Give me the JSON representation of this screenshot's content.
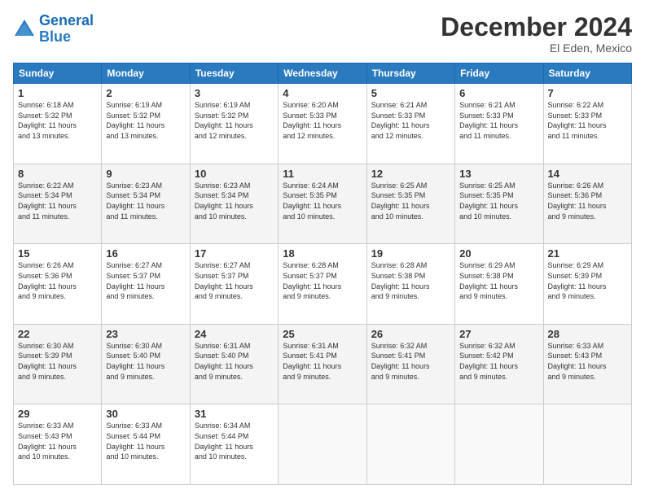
{
  "logo": {
    "line1": "General",
    "line2": "Blue"
  },
  "title": "December 2024",
  "location": "El Eden, Mexico",
  "days_header": [
    "Sunday",
    "Monday",
    "Tuesday",
    "Wednesday",
    "Thursday",
    "Friday",
    "Saturday"
  ],
  "weeks": [
    [
      {
        "day": "1",
        "info": "Sunrise: 6:18 AM\nSunset: 5:32 PM\nDaylight: 11 hours\nand 13 minutes."
      },
      {
        "day": "2",
        "info": "Sunrise: 6:19 AM\nSunset: 5:32 PM\nDaylight: 11 hours\nand 13 minutes."
      },
      {
        "day": "3",
        "info": "Sunrise: 6:19 AM\nSunset: 5:32 PM\nDaylight: 11 hours\nand 12 minutes."
      },
      {
        "day": "4",
        "info": "Sunrise: 6:20 AM\nSunset: 5:33 PM\nDaylight: 11 hours\nand 12 minutes."
      },
      {
        "day": "5",
        "info": "Sunrise: 6:21 AM\nSunset: 5:33 PM\nDaylight: 11 hours\nand 12 minutes."
      },
      {
        "day": "6",
        "info": "Sunrise: 6:21 AM\nSunset: 5:33 PM\nDaylight: 11 hours\nand 11 minutes."
      },
      {
        "day": "7",
        "info": "Sunrise: 6:22 AM\nSunset: 5:33 PM\nDaylight: 11 hours\nand 11 minutes."
      }
    ],
    [
      {
        "day": "8",
        "info": "Sunrise: 6:22 AM\nSunset: 5:34 PM\nDaylight: 11 hours\nand 11 minutes."
      },
      {
        "day": "9",
        "info": "Sunrise: 6:23 AM\nSunset: 5:34 PM\nDaylight: 11 hours\nand 11 minutes."
      },
      {
        "day": "10",
        "info": "Sunrise: 6:23 AM\nSunset: 5:34 PM\nDaylight: 11 hours\nand 10 minutes."
      },
      {
        "day": "11",
        "info": "Sunrise: 6:24 AM\nSunset: 5:35 PM\nDaylight: 11 hours\nand 10 minutes."
      },
      {
        "day": "12",
        "info": "Sunrise: 6:25 AM\nSunset: 5:35 PM\nDaylight: 11 hours\nand 10 minutes."
      },
      {
        "day": "13",
        "info": "Sunrise: 6:25 AM\nSunset: 5:35 PM\nDaylight: 11 hours\nand 10 minutes."
      },
      {
        "day": "14",
        "info": "Sunrise: 6:26 AM\nSunset: 5:36 PM\nDaylight: 11 hours\nand 9 minutes."
      }
    ],
    [
      {
        "day": "15",
        "info": "Sunrise: 6:26 AM\nSunset: 5:36 PM\nDaylight: 11 hours\nand 9 minutes."
      },
      {
        "day": "16",
        "info": "Sunrise: 6:27 AM\nSunset: 5:37 PM\nDaylight: 11 hours\nand 9 minutes."
      },
      {
        "day": "17",
        "info": "Sunrise: 6:27 AM\nSunset: 5:37 PM\nDaylight: 11 hours\nand 9 minutes."
      },
      {
        "day": "18",
        "info": "Sunrise: 6:28 AM\nSunset: 5:37 PM\nDaylight: 11 hours\nand 9 minutes."
      },
      {
        "day": "19",
        "info": "Sunrise: 6:28 AM\nSunset: 5:38 PM\nDaylight: 11 hours\nand 9 minutes."
      },
      {
        "day": "20",
        "info": "Sunrise: 6:29 AM\nSunset: 5:38 PM\nDaylight: 11 hours\nand 9 minutes."
      },
      {
        "day": "21",
        "info": "Sunrise: 6:29 AM\nSunset: 5:39 PM\nDaylight: 11 hours\nand 9 minutes."
      }
    ],
    [
      {
        "day": "22",
        "info": "Sunrise: 6:30 AM\nSunset: 5:39 PM\nDaylight: 11 hours\nand 9 minutes."
      },
      {
        "day": "23",
        "info": "Sunrise: 6:30 AM\nSunset: 5:40 PM\nDaylight: 11 hours\nand 9 minutes."
      },
      {
        "day": "24",
        "info": "Sunrise: 6:31 AM\nSunset: 5:40 PM\nDaylight: 11 hours\nand 9 minutes."
      },
      {
        "day": "25",
        "info": "Sunrise: 6:31 AM\nSunset: 5:41 PM\nDaylight: 11 hours\nand 9 minutes."
      },
      {
        "day": "26",
        "info": "Sunrise: 6:32 AM\nSunset: 5:41 PM\nDaylight: 11 hours\nand 9 minutes."
      },
      {
        "day": "27",
        "info": "Sunrise: 6:32 AM\nSunset: 5:42 PM\nDaylight: 11 hours\nand 9 minutes."
      },
      {
        "day": "28",
        "info": "Sunrise: 6:33 AM\nSunset: 5:43 PM\nDaylight: 11 hours\nand 9 minutes."
      }
    ],
    [
      {
        "day": "29",
        "info": "Sunrise: 6:33 AM\nSunset: 5:43 PM\nDaylight: 11 hours\nand 10 minutes."
      },
      {
        "day": "30",
        "info": "Sunrise: 6:33 AM\nSunset: 5:44 PM\nDaylight: 11 hours\nand 10 minutes."
      },
      {
        "day": "31",
        "info": "Sunrise: 6:34 AM\nSunset: 5:44 PM\nDaylight: 11 hours\nand 10 minutes."
      },
      {
        "day": "",
        "info": ""
      },
      {
        "day": "",
        "info": ""
      },
      {
        "day": "",
        "info": ""
      },
      {
        "day": "",
        "info": ""
      }
    ]
  ]
}
